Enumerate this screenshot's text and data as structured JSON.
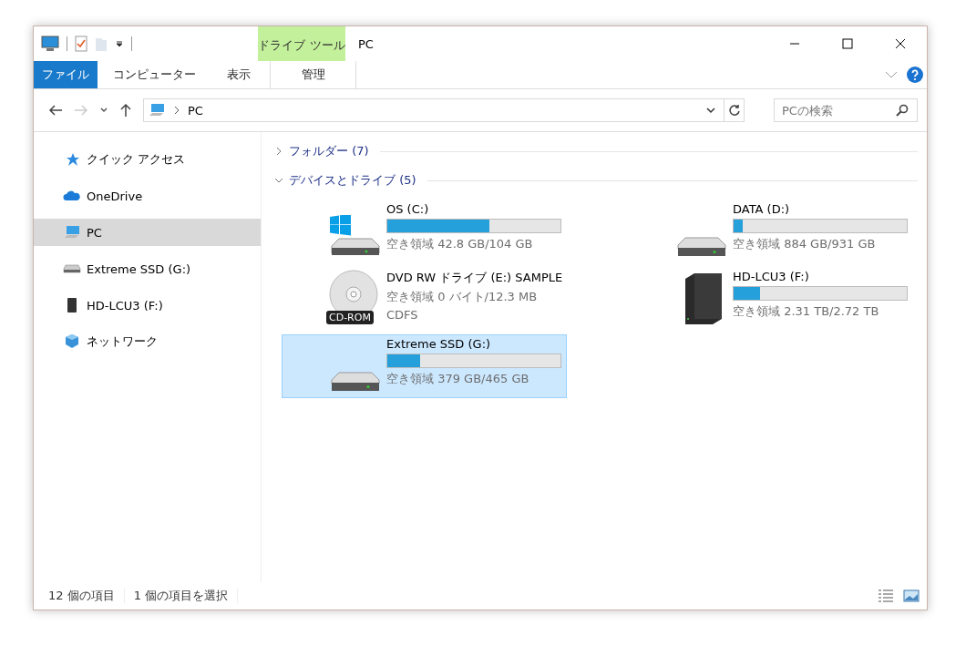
{
  "window": {
    "title": "PC",
    "context_tab": "ドライブ ツール"
  },
  "ribbon_tabs": [
    {
      "label": "ファイル",
      "kind": "file",
      "selected": false
    },
    {
      "label": "コンピューター",
      "kind": "normal",
      "selected": false
    },
    {
      "label": "表示",
      "kind": "normal",
      "selected": false
    },
    {
      "label": "管理",
      "kind": "context",
      "selected": false
    }
  ],
  "address": {
    "path": "PC"
  },
  "search": {
    "placeholder": "PCの検索"
  },
  "sidebar": {
    "items": [
      {
        "label": "クイック アクセス",
        "kind": "star",
        "selected": false
      },
      {
        "label": "OneDrive",
        "kind": "cloud",
        "selected": false
      },
      {
        "label": "PC",
        "kind": "pc",
        "selected": true
      },
      {
        "label": "Extreme SSD (G:)",
        "kind": "drive",
        "selected": false
      },
      {
        "label": "HD-LCU3 (F:)",
        "kind": "external",
        "selected": false
      },
      {
        "label": "ネットワーク",
        "kind": "network",
        "selected": false
      }
    ]
  },
  "groups": [
    {
      "title": "フォルダー (7)",
      "expanded": false
    },
    {
      "title": "デバイスとドライブ (5)",
      "expanded": true,
      "items": [
        {
          "name": "OS (C:)",
          "kind": "windows",
          "level": 0.59,
          "free": "空き領域 42.8 GB/104 GB",
          "selected": false
        },
        {
          "name": "DATA (D:)",
          "kind": "drive",
          "level": 0.05,
          "free": "空き領域 884 GB/931 GB",
          "selected": false
        },
        {
          "name": "DVD RW ドライブ (E:) SAMPLE",
          "kind": "dvd",
          "badge": "CD-ROM",
          "free": "空き領域 0 バイト/12.3 MB",
          "filesystem": "CDFS",
          "selected": false
        },
        {
          "name": "HD-LCU3 (F:)",
          "kind": "external",
          "level": 0.15,
          "free": "空き領域 2.31 TB/2.72 TB",
          "selected": false
        },
        {
          "name": "Extreme SSD (G:)",
          "kind": "drive",
          "level": 0.19,
          "free": "空き領域 379 GB/465 GB",
          "selected": true
        }
      ]
    }
  ],
  "status_bar": {
    "count": "12 個の項目",
    "selection": "1 個の項目を選択"
  }
}
